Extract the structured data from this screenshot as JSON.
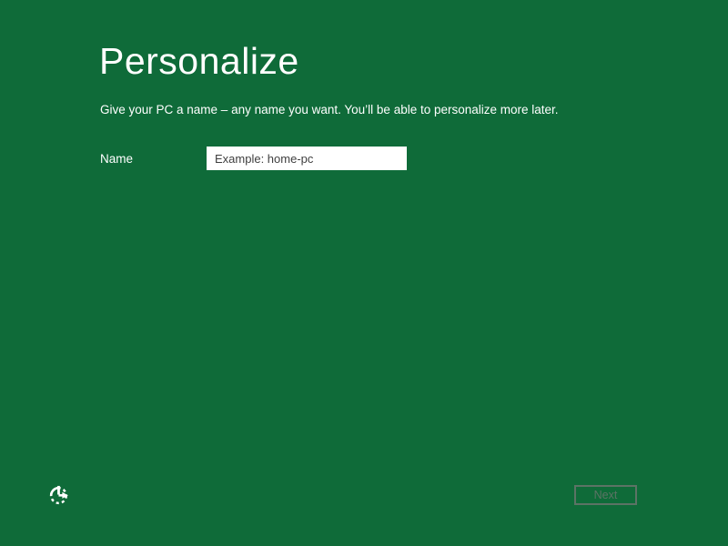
{
  "screen": {
    "title": "Personalize",
    "description": "Give your PC a name – any name you want. You’ll be able to personalize more later."
  },
  "form": {
    "name_label": "Name",
    "name_value": "",
    "name_placeholder": "Example: home-pc"
  },
  "footer": {
    "next_button_label": "Next",
    "next_button_state": "disabled",
    "ease_of_access_icon": "ease-of-access-clock-icon"
  },
  "colors": {
    "background": "#0F6B39",
    "title_text": "#FFFFFF",
    "body_text": "#FFFFFF",
    "input_background": "#FFFFFF",
    "input_placeholder_text": "#3F3F3F",
    "disabled_button_border": "#5C7365",
    "disabled_button_text": "#5C7365",
    "icon": "#FFFFFF"
  }
}
